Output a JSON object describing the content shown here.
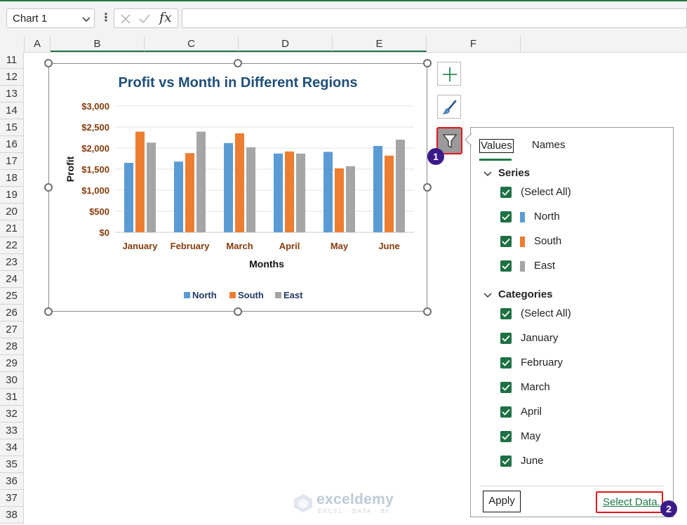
{
  "formula_bar": {
    "name_box_value": "Chart 1",
    "fx_label": "fx",
    "formula_value": ""
  },
  "columns": [
    "A",
    "B",
    "C",
    "D",
    "E",
    "F"
  ],
  "rows": [
    "11",
    "12",
    "13",
    "14",
    "15",
    "16",
    "17",
    "18",
    "19",
    "20",
    "21",
    "22",
    "23",
    "24",
    "25",
    "26",
    "27",
    "28",
    "29",
    "30",
    "31",
    "32",
    "33",
    "34",
    "35",
    "36",
    "37",
    "38"
  ],
  "chart_data": {
    "type": "bar",
    "title": "Profit vs Month in Different Regions",
    "xlabel": "Months",
    "ylabel": "Profit",
    "categories": [
      "January",
      "February",
      "March",
      "April",
      "May",
      "June"
    ],
    "y_ticks": [
      "$0",
      "$500",
      "$1,000",
      "$1,500",
      "$2,000",
      "$2,500",
      "$3,000"
    ],
    "ylim": [
      0,
      3000
    ],
    "grid": true,
    "legend_position": "bottom",
    "series": [
      {
        "name": "North",
        "color": "#5b9bd5",
        "values": [
          1650,
          1680,
          2120,
          1870,
          1910,
          2050
        ]
      },
      {
        "name": "South",
        "color": "#ed7d31",
        "values": [
          2390,
          1880,
          2350,
          1920,
          1520,
          1820
        ]
      },
      {
        "name": "East",
        "color": "#a5a5a5",
        "values": [
          2130,
          2390,
          2020,
          1870,
          1570,
          2200
        ]
      }
    ],
    "title_color": "#1f4e79",
    "tick_color": "#843c0c"
  },
  "filter_panel": {
    "tabs": {
      "values": "Values",
      "names": "Names"
    },
    "series_heading": "Series",
    "series_items": [
      {
        "label": "(Select All)",
        "checked": true,
        "swatch": ""
      },
      {
        "label": "North",
        "checked": true,
        "swatch": "#5b9bd5"
      },
      {
        "label": "South",
        "checked": true,
        "swatch": "#ed7d31"
      },
      {
        "label": "East",
        "checked": true,
        "swatch": "#a5a5a5"
      }
    ],
    "categories_heading": "Categories",
    "category_items": [
      {
        "label": "(Select All)",
        "checked": true
      },
      {
        "label": "January",
        "checked": true
      },
      {
        "label": "February",
        "checked": true
      },
      {
        "label": "March",
        "checked": true
      },
      {
        "label": "April",
        "checked": true
      },
      {
        "label": "May",
        "checked": true
      },
      {
        "label": "June",
        "checked": true
      }
    ],
    "apply_label": "Apply",
    "select_data_label": "Select Data..."
  },
  "badges": {
    "first": "1",
    "second": "2"
  },
  "watermark": {
    "name": "exceldemy",
    "sub": "EXCEL · DATA · BI"
  },
  "icons": {
    "chart_elements": "plus-icon",
    "chart_styles": "paintbrush-icon",
    "chart_filters": "funnel-icon"
  }
}
